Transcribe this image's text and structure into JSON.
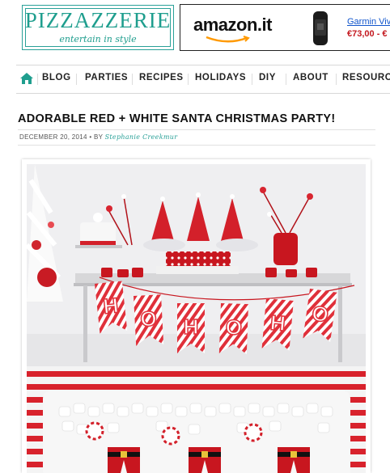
{
  "brand": {
    "name": "PIZZAZZERIE",
    "tagline": "entertain in style",
    "accent_color": "#1f9e8e"
  },
  "ad": {
    "store_logo": "amazon.it",
    "product_name": "Garmin Viv",
    "price": "€73,00 - €"
  },
  "nav": {
    "home_icon": "home-icon",
    "items": [
      "BLOG",
      "PARTIES",
      "RECIPES",
      "HOLIDAYS",
      "DIY",
      "ABOUT",
      "RESOURCE"
    ]
  },
  "post": {
    "title": "ADORABLE RED + WHITE SANTA CHRISTMAS PARTY!",
    "date": "DECEMBER 20, 2014",
    "by_label": "• BY",
    "author": "Stephanie Creekmur",
    "banner_letters": [
      "H",
      "O",
      "H",
      "O",
      "H",
      "O"
    ]
  }
}
